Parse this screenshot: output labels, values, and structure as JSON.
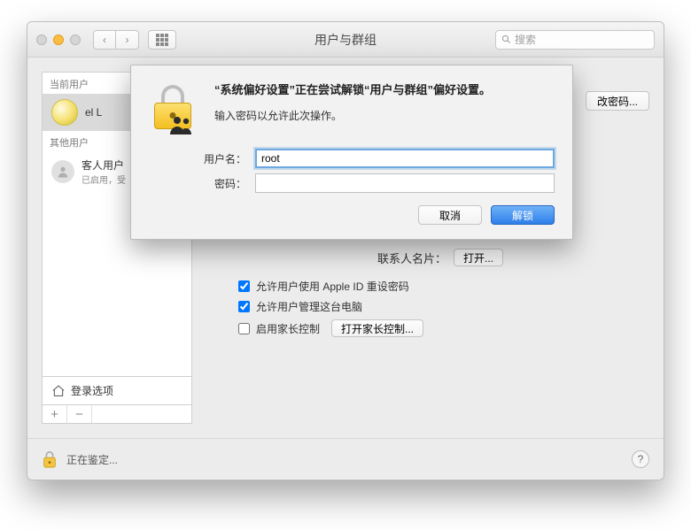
{
  "window": {
    "title": "用户与群组",
    "search_placeholder": "搜索"
  },
  "sidebar": {
    "current_user_label": "当前用户",
    "current_user_name": "el L",
    "other_users_label": "其他用户",
    "guest_name": "客人用户",
    "guest_sub": "已启用，受",
    "login_options": "登录选项"
  },
  "main": {
    "change_password_btn": "改密码...",
    "contact_card_label": "联系人名片：",
    "open_btn": "打开...",
    "opt_appleid": "允许用户使用 Apple ID 重设密码",
    "opt_admin": "允许用户管理这台电脑",
    "opt_parental": "启用家长控制",
    "parental_btn": "打开家长控制..."
  },
  "footer": {
    "text": "正在鉴定..."
  },
  "modal": {
    "title": "“系统偏好设置”正在尝试解锁“用户与群组”偏好设置。",
    "subtitle": "输入密码以允许此次操作。",
    "username_label": "用户名：",
    "username_value": "root",
    "password_label": "密码：",
    "password_value": "",
    "cancel": "取消",
    "unlock": "解锁"
  }
}
